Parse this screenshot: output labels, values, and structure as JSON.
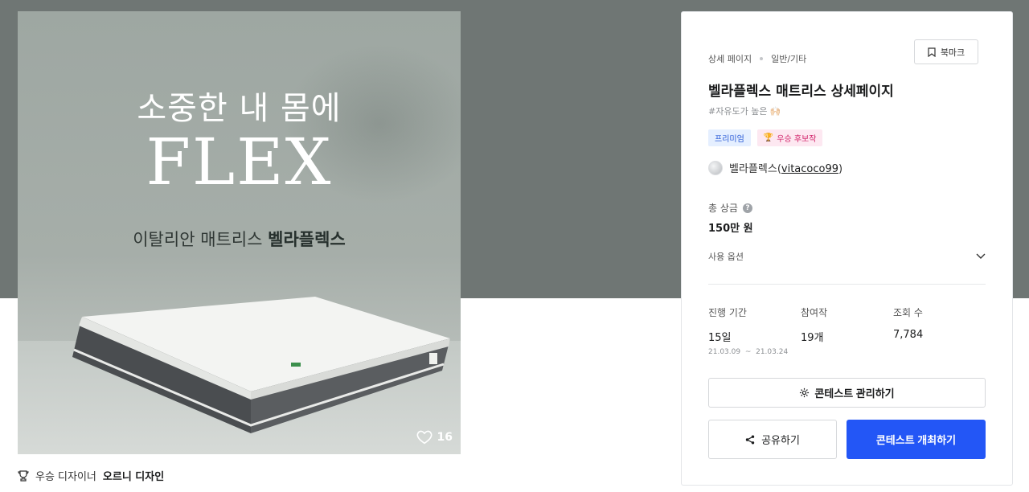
{
  "poster": {
    "line1": "소중한 내 몸에",
    "line2": "FLEX",
    "line3_prefix": "이탈리안 매트리스 ",
    "line3_brand": "벨라플렉스",
    "likes": "16",
    "like_icon": "heart-icon"
  },
  "designer": {
    "icon": "trophy-icon",
    "prefix": "우승 디자이너",
    "name": "오르니 디자인"
  },
  "panel": {
    "breadcrumb": [
      "상세 페이지",
      "일반/기타"
    ],
    "bookmark_label": "북마크",
    "title": "벨라플렉스 매트리스 상세페이지",
    "tag": "#자유도가 높은 🙌🏻",
    "badges": {
      "premium": "프리미엄",
      "winner": "우승 후보작",
      "winner_emoji": "🏆"
    },
    "host": {
      "name": "벨라플렉스",
      "handle": "vitacoco99"
    },
    "prize": {
      "label": "총 상금",
      "value": "150만 원"
    },
    "use_option_label": "사용 옵션",
    "stats": {
      "period": {
        "label": "진행 기간",
        "value": "15일",
        "range_start": "21.03.09",
        "range_sep": "~",
        "range_end": "21.03.24"
      },
      "participants": {
        "label": "참여작",
        "value": "19개"
      },
      "views": {
        "label": "조회 수",
        "value": "7,784"
      }
    },
    "buttons": {
      "manage": "콘테스트 관리하기",
      "share": "공유하기",
      "host": "콘테스트 개최하기"
    }
  },
  "colors": {
    "accent": "#2356f6",
    "hero_bg": "#6f7674",
    "premium_bg": "#e5efff",
    "winner_bg": "#fde8f1"
  }
}
